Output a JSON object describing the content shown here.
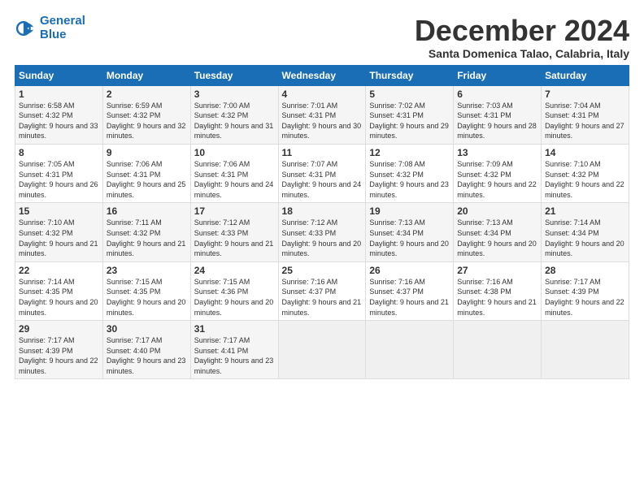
{
  "logo": {
    "line1": "General",
    "line2": "Blue"
  },
  "title": "December 2024",
  "location": "Santa Domenica Talao, Calabria, Italy",
  "days_of_week": [
    "Sunday",
    "Monday",
    "Tuesday",
    "Wednesday",
    "Thursday",
    "Friday",
    "Saturday"
  ],
  "weeks": [
    [
      {
        "day": "1",
        "sunrise": "6:58 AM",
        "sunset": "4:32 PM",
        "daylight": "9 hours and 33 minutes."
      },
      {
        "day": "2",
        "sunrise": "6:59 AM",
        "sunset": "4:32 PM",
        "daylight": "9 hours and 32 minutes."
      },
      {
        "day": "3",
        "sunrise": "7:00 AM",
        "sunset": "4:32 PM",
        "daylight": "9 hours and 31 minutes."
      },
      {
        "day": "4",
        "sunrise": "7:01 AM",
        "sunset": "4:31 PM",
        "daylight": "9 hours and 30 minutes."
      },
      {
        "day": "5",
        "sunrise": "7:02 AM",
        "sunset": "4:31 PM",
        "daylight": "9 hours and 29 minutes."
      },
      {
        "day": "6",
        "sunrise": "7:03 AM",
        "sunset": "4:31 PM",
        "daylight": "9 hours and 28 minutes."
      },
      {
        "day": "7",
        "sunrise": "7:04 AM",
        "sunset": "4:31 PM",
        "daylight": "9 hours and 27 minutes."
      }
    ],
    [
      {
        "day": "8",
        "sunrise": "7:05 AM",
        "sunset": "4:31 PM",
        "daylight": "9 hours and 26 minutes."
      },
      {
        "day": "9",
        "sunrise": "7:06 AM",
        "sunset": "4:31 PM",
        "daylight": "9 hours and 25 minutes."
      },
      {
        "day": "10",
        "sunrise": "7:06 AM",
        "sunset": "4:31 PM",
        "daylight": "9 hours and 24 minutes."
      },
      {
        "day": "11",
        "sunrise": "7:07 AM",
        "sunset": "4:31 PM",
        "daylight": "9 hours and 24 minutes."
      },
      {
        "day": "12",
        "sunrise": "7:08 AM",
        "sunset": "4:32 PM",
        "daylight": "9 hours and 23 minutes."
      },
      {
        "day": "13",
        "sunrise": "7:09 AM",
        "sunset": "4:32 PM",
        "daylight": "9 hours and 22 minutes."
      },
      {
        "day": "14",
        "sunrise": "7:10 AM",
        "sunset": "4:32 PM",
        "daylight": "9 hours and 22 minutes."
      }
    ],
    [
      {
        "day": "15",
        "sunrise": "7:10 AM",
        "sunset": "4:32 PM",
        "daylight": "9 hours and 21 minutes."
      },
      {
        "day": "16",
        "sunrise": "7:11 AM",
        "sunset": "4:32 PM",
        "daylight": "9 hours and 21 minutes."
      },
      {
        "day": "17",
        "sunrise": "7:12 AM",
        "sunset": "4:33 PM",
        "daylight": "9 hours and 21 minutes."
      },
      {
        "day": "18",
        "sunrise": "7:12 AM",
        "sunset": "4:33 PM",
        "daylight": "9 hours and 20 minutes."
      },
      {
        "day": "19",
        "sunrise": "7:13 AM",
        "sunset": "4:34 PM",
        "daylight": "9 hours and 20 minutes."
      },
      {
        "day": "20",
        "sunrise": "7:13 AM",
        "sunset": "4:34 PM",
        "daylight": "9 hours and 20 minutes."
      },
      {
        "day": "21",
        "sunrise": "7:14 AM",
        "sunset": "4:34 PM",
        "daylight": "9 hours and 20 minutes."
      }
    ],
    [
      {
        "day": "22",
        "sunrise": "7:14 AM",
        "sunset": "4:35 PM",
        "daylight": "9 hours and 20 minutes."
      },
      {
        "day": "23",
        "sunrise": "7:15 AM",
        "sunset": "4:35 PM",
        "daylight": "9 hours and 20 minutes."
      },
      {
        "day": "24",
        "sunrise": "7:15 AM",
        "sunset": "4:36 PM",
        "daylight": "9 hours and 20 minutes."
      },
      {
        "day": "25",
        "sunrise": "7:16 AM",
        "sunset": "4:37 PM",
        "daylight": "9 hours and 21 minutes."
      },
      {
        "day": "26",
        "sunrise": "7:16 AM",
        "sunset": "4:37 PM",
        "daylight": "9 hours and 21 minutes."
      },
      {
        "day": "27",
        "sunrise": "7:16 AM",
        "sunset": "4:38 PM",
        "daylight": "9 hours and 21 minutes."
      },
      {
        "day": "28",
        "sunrise": "7:17 AM",
        "sunset": "4:39 PM",
        "daylight": "9 hours and 22 minutes."
      }
    ],
    [
      {
        "day": "29",
        "sunrise": "7:17 AM",
        "sunset": "4:39 PM",
        "daylight": "9 hours and 22 minutes."
      },
      {
        "day": "30",
        "sunrise": "7:17 AM",
        "sunset": "4:40 PM",
        "daylight": "9 hours and 23 minutes."
      },
      {
        "day": "31",
        "sunrise": "7:17 AM",
        "sunset": "4:41 PM",
        "daylight": "9 hours and 23 minutes."
      },
      null,
      null,
      null,
      null
    ]
  ],
  "labels": {
    "sunrise": "Sunrise:",
    "sunset": "Sunset:",
    "daylight": "Daylight:"
  }
}
